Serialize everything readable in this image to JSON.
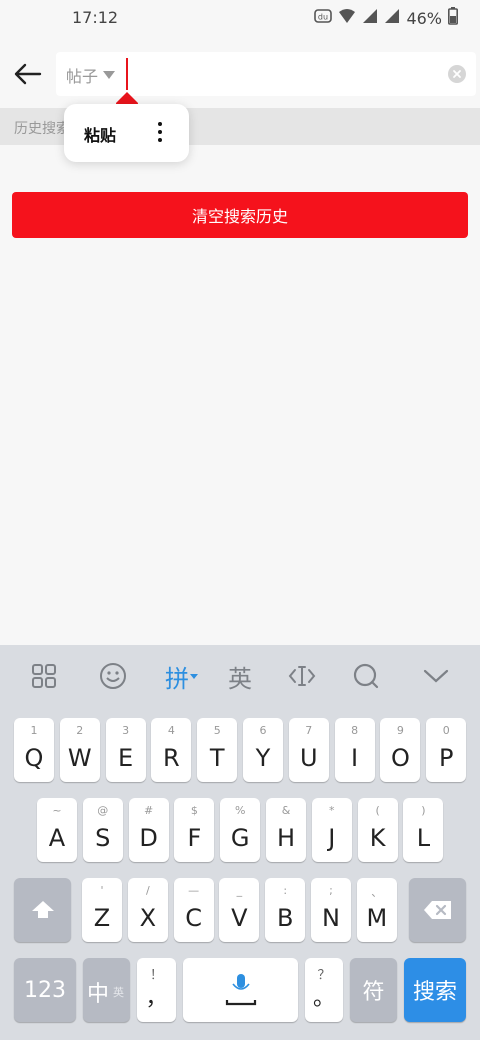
{
  "status_bar": {
    "time": "17:12",
    "battery": "46%",
    "app_icon": "baidu-du-icon",
    "wifi_icon": "wifi-icon",
    "signal_icon": "cell-signal-icon",
    "battery_icon": "battery-icon"
  },
  "header": {
    "back_icon": "arrow-left-icon",
    "scope_label": "帖子",
    "scope_icon": "triangle-down-icon",
    "clear_icon": "close-circle-icon"
  },
  "history": {
    "label": "历史搜索",
    "clear_button": "清空搜索历史"
  },
  "context_menu": {
    "paste": "粘贴",
    "more_icon": "more-vertical-icon"
  },
  "keyboard": {
    "toolbar": {
      "grid_icon": "apps-grid-icon",
      "emoji_icon": "emoji-icon",
      "pinyin": "拼",
      "english": "英",
      "cursor_icon": "cursor-move-icon",
      "search_icon": "search-icon",
      "collapse_icon": "chevron-down-icon"
    },
    "row1": [
      {
        "main": "Q",
        "sub": "1"
      },
      {
        "main": "W",
        "sub": "2"
      },
      {
        "main": "E",
        "sub": "3"
      },
      {
        "main": "R",
        "sub": "4"
      },
      {
        "main": "T",
        "sub": "5"
      },
      {
        "main": "Y",
        "sub": "6"
      },
      {
        "main": "U",
        "sub": "7"
      },
      {
        "main": "I",
        "sub": "8"
      },
      {
        "main": "O",
        "sub": "9"
      },
      {
        "main": "P",
        "sub": "0"
      }
    ],
    "row2": [
      {
        "main": "A",
        "sub": "~"
      },
      {
        "main": "S",
        "sub": "@"
      },
      {
        "main": "D",
        "sub": "#"
      },
      {
        "main": "F",
        "sub": "$"
      },
      {
        "main": "G",
        "sub": "%"
      },
      {
        "main": "H",
        "sub": "&"
      },
      {
        "main": "J",
        "sub": "*"
      },
      {
        "main": "K",
        "sub": "("
      },
      {
        "main": "L",
        "sub": ")"
      }
    ],
    "row3": [
      {
        "main": "Z",
        "sub": "'"
      },
      {
        "main": "X",
        "sub": "/"
      },
      {
        "main": "C",
        "sub": "—"
      },
      {
        "main": "V",
        "sub": "_"
      },
      {
        "main": "B",
        "sub": ":"
      },
      {
        "main": "N",
        "sub": ";"
      },
      {
        "main": "M",
        "sub": "、"
      }
    ],
    "shift_icon": "shift-icon",
    "backspace_icon": "backspace-icon",
    "num_key": "123",
    "lang_key": "中",
    "lang_sub": "英",
    "comma_key": "，",
    "comma_sub": "！",
    "mic_icon": "microphone-icon",
    "period_key": "。",
    "period_sub": "？",
    "symbol_key": "符",
    "search_key": "搜索"
  }
}
